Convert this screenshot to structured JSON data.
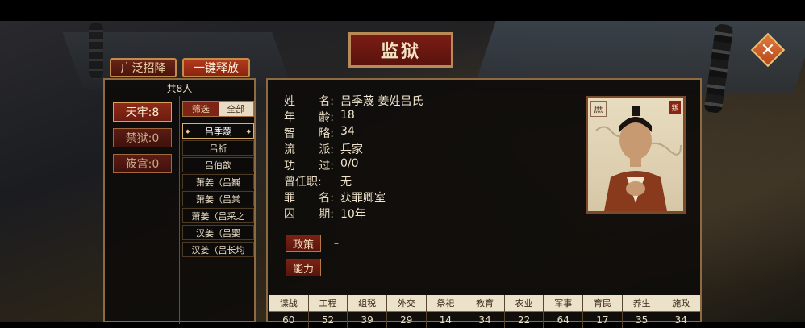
{
  "title": "监狱",
  "close_icon": "close-icon",
  "top_buttons": {
    "guangfan": "广泛招降",
    "release_all": "一键释放"
  },
  "count_label": "共8人",
  "categories": [
    {
      "label": "天牢:8",
      "active": true
    },
    {
      "label": "禁狱:0",
      "active": false
    },
    {
      "label": "筱宫:0",
      "active": false
    }
  ],
  "filter": {
    "label": "筛选",
    "value": "全部"
  },
  "prisoners": [
    "吕季蔑",
    "吕祈",
    "吕伯歆",
    "萧姜（吕巍",
    "萧姜（吕棠",
    "萧姜（吕采之",
    "汉姜（吕婴",
    "汉姜（吕长均"
  ],
  "info": {
    "name": {
      "label": [
        "姓",
        "名:"
      ],
      "value": "吕季蔑 姜姓吕氏"
    },
    "age": {
      "label": [
        "年",
        "龄:"
      ],
      "value": "18"
    },
    "intellect": {
      "label": [
        "智",
        "略:"
      ],
      "value": "34"
    },
    "school": {
      "label": [
        "流",
        "派:"
      ],
      "value": "兵家"
    },
    "merit": {
      "label": [
        "功",
        "过:"
      ],
      "value": "0/0"
    },
    "former_post": {
      "label": [
        "曾任职:"
      ],
      "value": "无"
    },
    "crime": {
      "label": [
        "罪",
        "名:"
      ],
      "value": "获罪卿室"
    },
    "sentence": {
      "label": [
        "囚",
        "期:"
      ],
      "value": "10年"
    }
  },
  "actions": [
    {
      "label": "政策",
      "value": "–"
    },
    {
      "label": "能力",
      "value": "–"
    }
  ],
  "portrait": {
    "badge_left": "庶",
    "badge_right": "叛"
  },
  "stats": [
    {
      "name": "谍战",
      "value": "60"
    },
    {
      "name": "工程",
      "value": "52"
    },
    {
      "name": "组税",
      "value": "39"
    },
    {
      "name": "外交",
      "value": "29"
    },
    {
      "name": "祭祀",
      "value": "14"
    },
    {
      "name": "教育",
      "value": "34"
    },
    {
      "name": "农业",
      "value": "22"
    },
    {
      "name": "军事",
      "value": "64"
    },
    {
      "name": "育民",
      "value": "17"
    },
    {
      "name": "养生",
      "value": "35"
    },
    {
      "name": "施政",
      "value": "34"
    }
  ]
}
